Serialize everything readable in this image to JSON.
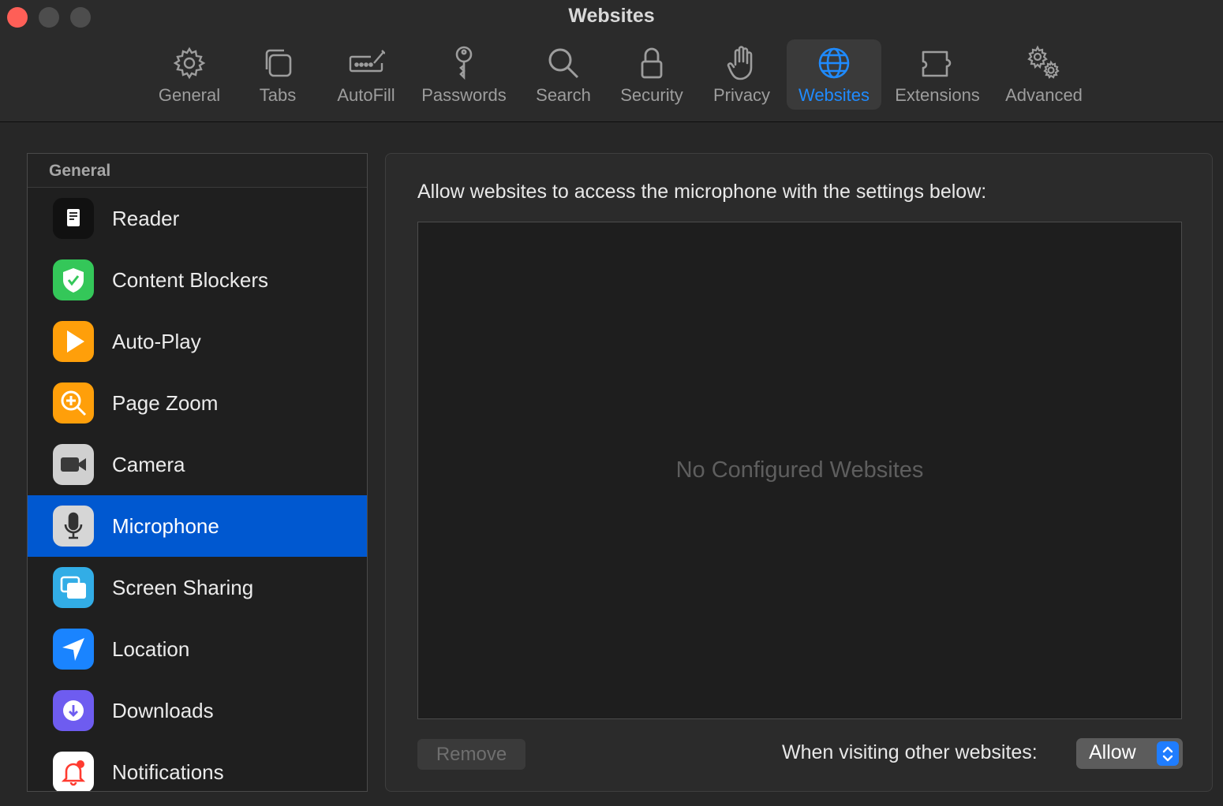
{
  "window": {
    "title": "Websites"
  },
  "toolbar": {
    "tabs": [
      {
        "label": "General",
        "icon": "gear-icon"
      },
      {
        "label": "Tabs",
        "icon": "tabs-icon"
      },
      {
        "label": "AutoFill",
        "icon": "autofill-icon"
      },
      {
        "label": "Passwords",
        "icon": "key-icon"
      },
      {
        "label": "Search",
        "icon": "search-icon"
      },
      {
        "label": "Security",
        "icon": "lock-icon"
      },
      {
        "label": "Privacy",
        "icon": "hand-icon"
      },
      {
        "label": "Websites",
        "icon": "globe-icon",
        "active": true
      },
      {
        "label": "Extensions",
        "icon": "puzzle-icon"
      },
      {
        "label": "Advanced",
        "icon": "gears-icon"
      }
    ],
    "accent_color": "#1f8bff"
  },
  "sidebar": {
    "header": "General",
    "items": [
      {
        "label": "Reader",
        "icon": "reader-icon"
      },
      {
        "label": "Content Blockers",
        "icon": "shield-icon"
      },
      {
        "label": "Auto-Play",
        "icon": "play-icon"
      },
      {
        "label": "Page Zoom",
        "icon": "zoom-icon"
      },
      {
        "label": "Camera",
        "icon": "camera-icon"
      },
      {
        "label": "Microphone",
        "icon": "microphone-icon",
        "selected": true
      },
      {
        "label": "Screen Sharing",
        "icon": "screen-sharing-icon"
      },
      {
        "label": "Location",
        "icon": "location-icon"
      },
      {
        "label": "Downloads",
        "icon": "download-icon"
      },
      {
        "label": "Notifications",
        "icon": "bell-icon"
      }
    ],
    "selection_color": "#0058d0"
  },
  "main": {
    "description": "Allow websites to access the microphone with the settings below:",
    "empty_message": "No Configured Websites",
    "remove_label": "Remove",
    "other_websites_label": "When visiting other websites:",
    "other_websites_value": "Allow"
  }
}
